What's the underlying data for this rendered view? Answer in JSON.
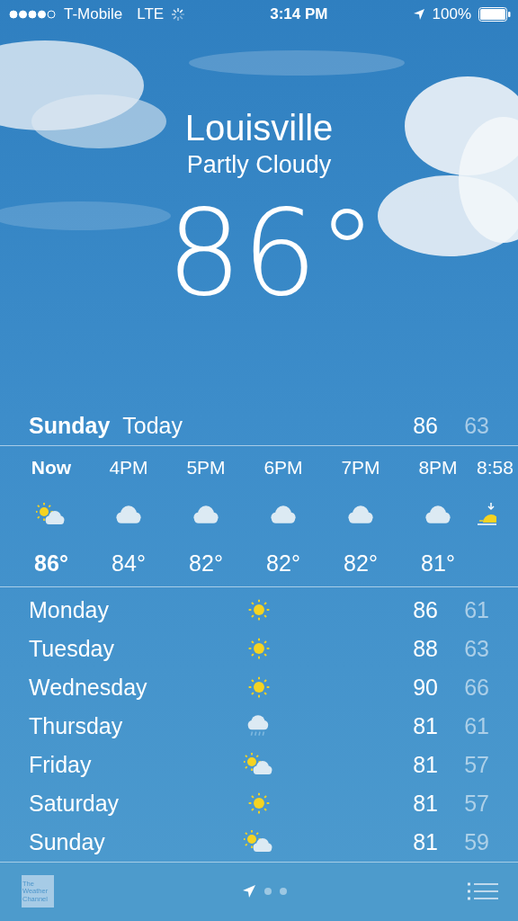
{
  "status_bar": {
    "carrier": "T-Mobile",
    "network": "LTE",
    "time": "3:14 PM",
    "battery": "100%"
  },
  "location": {
    "city": "Louisville",
    "condition": "Partly Cloudy",
    "temperature": "86°"
  },
  "today": {
    "day": "Sunday",
    "label": "Today",
    "high": "86",
    "low": "63"
  },
  "hourly": [
    {
      "time": "Now",
      "current": true,
      "kind": "partly",
      "temp": "86°"
    },
    {
      "time": "4PM",
      "current": false,
      "kind": "cloud",
      "temp": "84°"
    },
    {
      "time": "5PM",
      "current": false,
      "kind": "cloud",
      "temp": "82°"
    },
    {
      "time": "6PM",
      "current": false,
      "kind": "cloud",
      "temp": "82°"
    },
    {
      "time": "7PM",
      "current": false,
      "kind": "cloud",
      "temp": "82°"
    },
    {
      "time": "8PM",
      "current": false,
      "kind": "cloud",
      "temp": "81°"
    },
    {
      "time": "8:58",
      "current": false,
      "kind": "sunset"
    }
  ],
  "daily": [
    {
      "day": "Monday",
      "kind": "sun",
      "high": "86",
      "low": "61"
    },
    {
      "day": "Tuesday",
      "kind": "sun",
      "high": "88",
      "low": "63"
    },
    {
      "day": "Wednesday",
      "kind": "sun",
      "high": "90",
      "low": "66"
    },
    {
      "day": "Thursday",
      "kind": "rain",
      "high": "81",
      "low": "61"
    },
    {
      "day": "Friday",
      "kind": "partly",
      "high": "81",
      "low": "57"
    },
    {
      "day": "Saturday",
      "kind": "sun",
      "high": "81",
      "low": "57"
    },
    {
      "day": "Sunday",
      "kind": "partly",
      "high": "81",
      "low": "59"
    }
  ],
  "bottom_bar": {
    "logo": [
      "The",
      "Weather",
      "Channel"
    ],
    "pages": [
      {
        "kind": "location",
        "selected": true
      },
      {
        "kind": "dot",
        "selected": false
      },
      {
        "kind": "dot",
        "selected": false
      }
    ]
  }
}
